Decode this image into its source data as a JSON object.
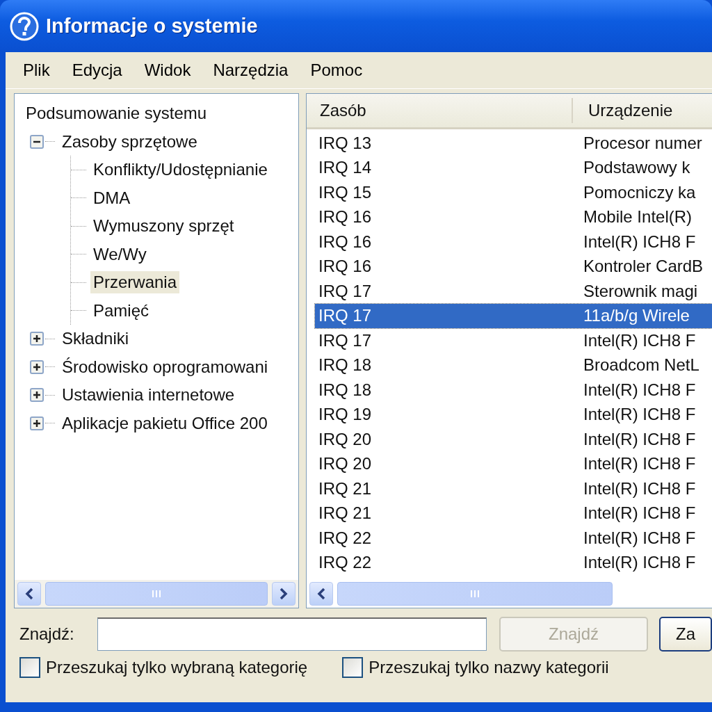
{
  "window": {
    "title": "Informacje o systemie"
  },
  "menu": [
    "Plik",
    "Edycja",
    "Widok",
    "Narzędzia",
    "Pomoc"
  ],
  "tree": [
    {
      "label": "Podsumowanie systemu",
      "selected": false,
      "children": [
        {
          "label": "Zasoby sprzętowe",
          "selected": false,
          "expanded": true,
          "children": [
            {
              "label": "Konflikty/Udostępnianie",
              "selected": false
            },
            {
              "label": "DMA",
              "selected": false
            },
            {
              "label": "Wymuszony sprzęt",
              "selected": false
            },
            {
              "label": "We/Wy",
              "selected": false
            },
            {
              "label": "Przerwania",
              "selected": true
            },
            {
              "label": "Pamięć",
              "selected": false
            }
          ]
        },
        {
          "label": "Składniki",
          "selected": false,
          "expanded": false
        },
        {
          "label": "Środowisko oprogramowani",
          "selected": false,
          "expanded": false
        },
        {
          "label": "Ustawienia internetowe",
          "selected": false,
          "expanded": false
        },
        {
          "label": "Aplikacje pakietu Office 200",
          "selected": false,
          "expanded": false
        }
      ]
    }
  ],
  "table": {
    "columns": [
      "Zasób",
      "Urządzenie"
    ],
    "rows": [
      {
        "resource": "IRQ 13",
        "device": "Procesor numer",
        "selected": false
      },
      {
        "resource": "IRQ 14",
        "device": "Podstawowy k",
        "selected": false
      },
      {
        "resource": "IRQ 15",
        "device": "Pomocniczy ka",
        "selected": false
      },
      {
        "resource": "IRQ 16",
        "device": "Mobile Intel(R)",
        "selected": false
      },
      {
        "resource": "IRQ 16",
        "device": "Intel(R) ICH8 F",
        "selected": false
      },
      {
        "resource": "IRQ 16",
        "device": "Kontroler CardB",
        "selected": false
      },
      {
        "resource": "IRQ 17",
        "device": "Sterownik magi",
        "selected": false
      },
      {
        "resource": "IRQ 17",
        "device": "11a/b/g Wirele",
        "selected": true
      },
      {
        "resource": "IRQ 17",
        "device": "Intel(R) ICH8 F",
        "selected": false
      },
      {
        "resource": "IRQ 18",
        "device": "Broadcom NetL",
        "selected": false
      },
      {
        "resource": "IRQ 18",
        "device": "Intel(R) ICH8 F",
        "selected": false
      },
      {
        "resource": "IRQ 19",
        "device": "Intel(R) ICH8 F",
        "selected": false
      },
      {
        "resource": "IRQ 20",
        "device": "Intel(R) ICH8 F",
        "selected": false
      },
      {
        "resource": "IRQ 20",
        "device": "Intel(R) ICH8 F",
        "selected": false
      },
      {
        "resource": "IRQ 21",
        "device": "Intel(R) ICH8 F",
        "selected": false
      },
      {
        "resource": "IRQ 21",
        "device": "Intel(R) ICH8 F",
        "selected": false
      },
      {
        "resource": "IRQ 22",
        "device": "Intel(R) ICH8 F",
        "selected": false
      },
      {
        "resource": "IRQ 22",
        "device": "Intel(R) ICH8 F",
        "selected": false
      }
    ]
  },
  "find": {
    "label": "Znajdź:",
    "buttons": [
      {
        "label": "Znajdź",
        "disabled": true
      },
      {
        "label": "Za",
        "disabled": false
      }
    ]
  },
  "options": [
    {
      "label": "Przeszukaj tylko wybraną kategorię",
      "checked": false
    },
    {
      "label": "Przeszukaj tylko nazwy kategorii",
      "checked": false
    }
  ]
}
